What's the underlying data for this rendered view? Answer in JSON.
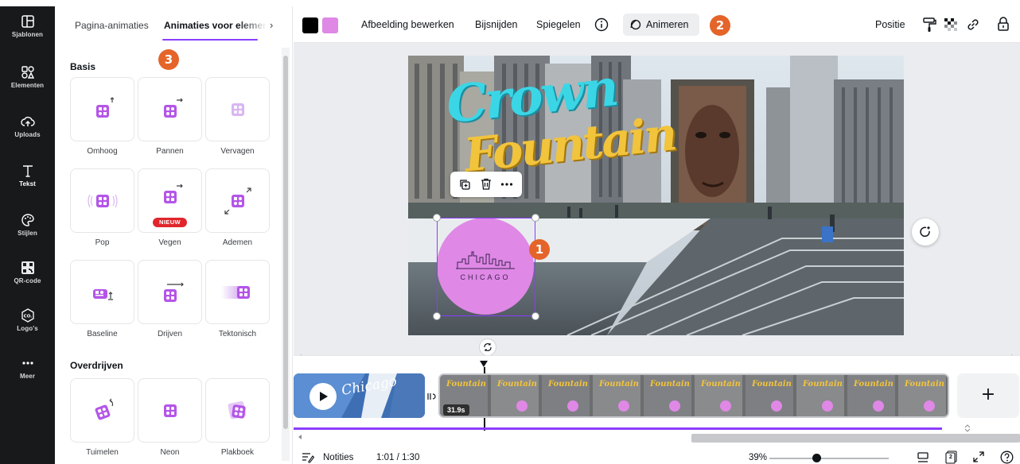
{
  "rail": {
    "items": [
      {
        "label": "Sjablonen",
        "icon": "templates-icon"
      },
      {
        "label": "Elementen",
        "icon": "elements-icon"
      },
      {
        "label": "Uploads",
        "icon": "upload-cloud-icon"
      },
      {
        "label": "Tekst",
        "icon": "text-icon"
      },
      {
        "label": "Stijlen",
        "icon": "palette-icon"
      },
      {
        "label": "QR-code",
        "icon": "qr-code-icon"
      },
      {
        "label": "Logo's",
        "icon": "logo-icon"
      },
      {
        "label": "Meer",
        "icon": "more-dots-icon"
      }
    ]
  },
  "panel": {
    "tabs": [
      {
        "label": "Pagina-animaties",
        "active": false
      },
      {
        "label": "Animaties voor elemen",
        "active": true
      }
    ],
    "sections": [
      {
        "title": "Basis",
        "items": [
          {
            "label": "Omhoog"
          },
          {
            "label": "Pannen"
          },
          {
            "label": "Vervagen"
          },
          {
            "label": "Pop"
          },
          {
            "label": "Vegen",
            "badge": "NIEUW"
          },
          {
            "label": "Ademen"
          },
          {
            "label": "Baseline"
          },
          {
            "label": "Drijven"
          },
          {
            "label": "Tektonisch"
          }
        ]
      },
      {
        "title": "Overdrijven",
        "items": [
          {
            "label": "Tuimelen"
          },
          {
            "label": "Neon"
          },
          {
            "label": "Plakboek"
          }
        ]
      }
    ]
  },
  "markers": [
    "1",
    "2",
    "3"
  ],
  "toolbar": {
    "colors": [
      "#000000",
      "#df88e6"
    ],
    "edit_image": "Afbeelding bewerken",
    "crop": "Bijsnijden",
    "flip": "Spiegelen",
    "animate": "Animeren",
    "position": "Positie"
  },
  "canvas": {
    "title_line1": "Crown",
    "title_line2": "Fountain",
    "badge_text": "CHICAGO"
  },
  "timeline": {
    "clip1_text": "Chicago",
    "clip2_duration": "31.9s",
    "frame_text": "Fountain",
    "add_label": "+"
  },
  "status": {
    "notes": "Notities",
    "time": "1:01 / 1:30",
    "zoom": "39%",
    "zoom_fraction": 0.39,
    "page_count": "2"
  },
  "colors": {
    "accent": "#8b3dff",
    "marker": "#e4642a",
    "badge_new": "#e0262c",
    "pink": "#df88e6"
  }
}
